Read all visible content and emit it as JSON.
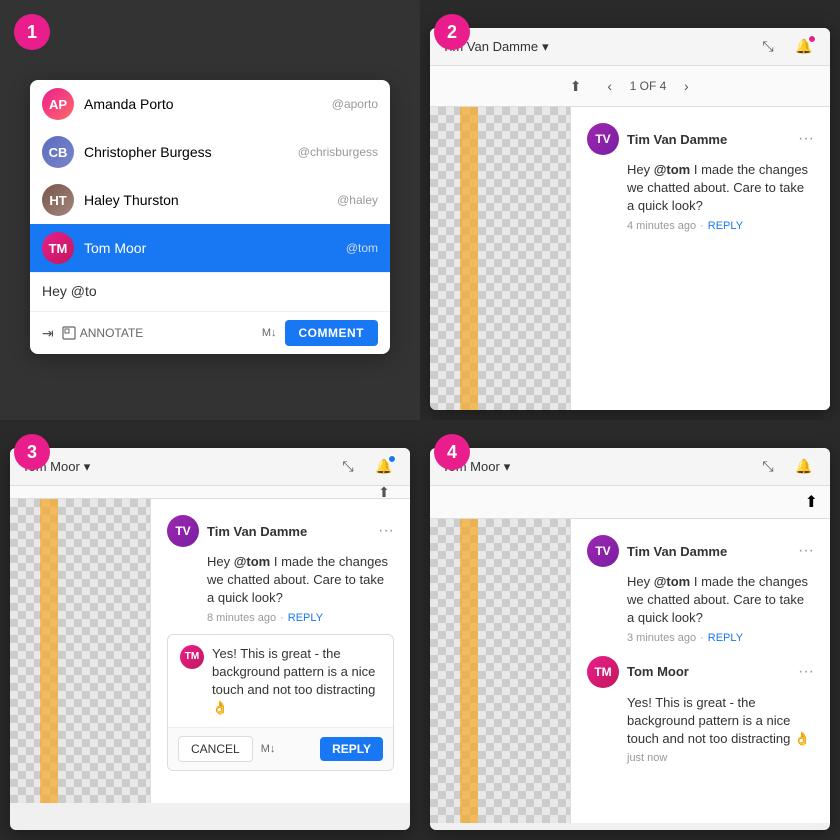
{
  "badges": {
    "q1": "1",
    "q2": "2",
    "q3": "3",
    "q4": "4"
  },
  "q1": {
    "users": [
      {
        "id": "ap",
        "name": "Amanda Porto",
        "handle": "@aporto",
        "avatar": "ap"
      },
      {
        "id": "cb",
        "name": "Christopher Burgess",
        "handle": "@chrisburgess",
        "avatar": "cb"
      },
      {
        "id": "ht",
        "name": "Haley Thurston",
        "handle": "@haley",
        "avatar": "ht"
      },
      {
        "id": "tm",
        "name": "Tom Moor",
        "handle": "@tom",
        "avatar": "tm",
        "selected": true
      }
    ],
    "input_value": "Hey @to",
    "annotate_label": "ANNOTATE",
    "comment_label": "COMMENT"
  },
  "q2": {
    "user": "Tim Van Damme",
    "nav_counter": "1 OF 4",
    "comment": {
      "author": "Tim Van Damme",
      "text_before": "Hey ",
      "mention": "@tom",
      "text_after": " I made the changes we chatted about. Care to take a quick look?",
      "time": "4 minutes ago",
      "reply_label": "REPLY"
    }
  },
  "q3": {
    "user": "Tom Moor",
    "comment": {
      "author": "Tim Van Damme",
      "text_before": "Hey ",
      "mention": "@tom",
      "text_after": " I made the changes we chatted about. Care to take a quick look?",
      "time": "8 minutes ago",
      "reply_label": "REPLY"
    },
    "reply_avatar": "tm",
    "reply_text": "Yes! This is great - the background pattern is a nice touch and not too distracting 👌",
    "cancel_label": "CANCEL",
    "reply_label": "REPLY"
  },
  "q4": {
    "user": "Tom Moor",
    "comment": {
      "author": "Tim Van Damme",
      "text_before": "Hey ",
      "mention": "@tom",
      "text_after": " I made the changes we chatted about. Care to take a quick look?",
      "time": "3 minutes ago",
      "reply_label": "REPLY"
    },
    "reply": {
      "author": "Tom Moor",
      "text": "Yes! This is great - the background pattern is a nice touch and not too distracting 👌",
      "time": "just now"
    }
  }
}
